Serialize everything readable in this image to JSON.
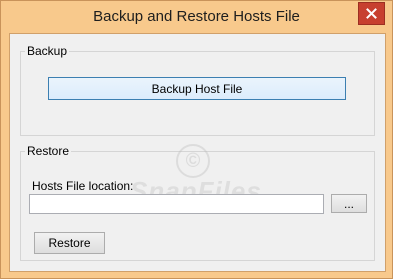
{
  "window": {
    "title": "Backup and Restore Hosts File",
    "close_icon": "close-icon",
    "colors": {
      "frame": "#f8c98c",
      "close": "#c7402f",
      "client": "#f0f0f0",
      "focus_border": "#3c7fb1"
    }
  },
  "backup": {
    "group_label": "Backup",
    "button_label": "Backup Host File"
  },
  "restore": {
    "group_label": "Restore",
    "location_label": "Hosts File location:",
    "location_value": "",
    "browse_label": "...",
    "button_label": "Restore"
  },
  "watermark": {
    "symbol": "©",
    "text": "SnapFiles"
  }
}
